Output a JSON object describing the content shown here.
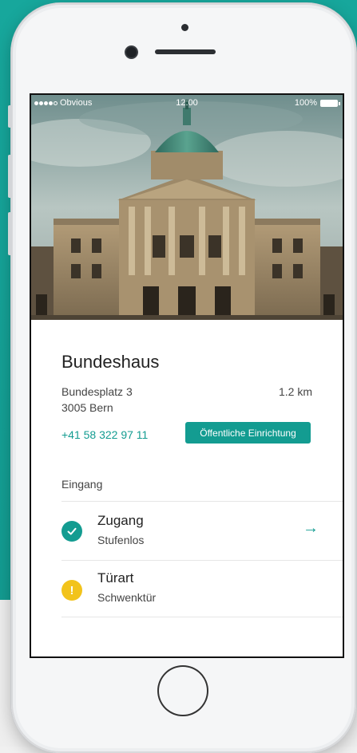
{
  "status_bar": {
    "carrier": "Obvious",
    "time": "12:00",
    "battery": "100%"
  },
  "place": {
    "name": "Bundeshaus",
    "address_line1": "Bundesplatz 3",
    "address_line2": "3005 Bern",
    "distance": "1.2 km",
    "phone": "+41 58 322 97 11",
    "category": "Öffentliche Einrichtung"
  },
  "section": {
    "label": "Eingang",
    "items": [
      {
        "title": "Zugang",
        "subtitle": "Stufenlos",
        "status_icon": "check-icon",
        "status_color": "#139c91"
      },
      {
        "title": "Türart",
        "subtitle": "Schwenktür",
        "status_icon": "warning-icon",
        "status_color": "#f2c31b"
      }
    ]
  },
  "colors": {
    "accent": "#139c91",
    "background": "#17a79c"
  }
}
